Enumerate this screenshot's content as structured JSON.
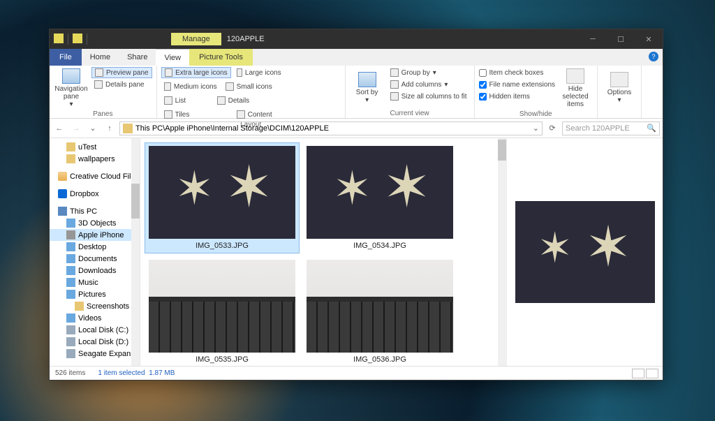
{
  "title": "120APPLE",
  "context_tab": "Manage",
  "ribbon_tabs": {
    "file": "File",
    "home": "Home",
    "share": "Share",
    "view": "View",
    "tools": "Picture Tools"
  },
  "panes": {
    "label": "Panes",
    "nav": "Navigation pane",
    "preview": "Preview pane",
    "details": "Details pane"
  },
  "layout": {
    "label": "Layout",
    "xl": "Extra large icons",
    "lg": "Large icons",
    "md": "Medium icons",
    "sm": "Small icons",
    "list": "List",
    "det": "Details",
    "tiles": "Tiles",
    "content": "Content"
  },
  "currentview": {
    "label": "Current view",
    "sort": "Sort by",
    "group": "Group by",
    "addcols": "Add columns",
    "sizecols": "Size all columns to fit"
  },
  "showhide": {
    "label": "Show/hide",
    "checkboxes": "Item check boxes",
    "ext": "File name extensions",
    "hidden": "Hidden items",
    "hidesel": "Hide selected items"
  },
  "options": "Options",
  "address": "This PC\\Apple iPhone\\Internal Storage\\DCIM\\120APPLE",
  "search_placeholder": "Search 120APPLE",
  "tree": {
    "utest": "uTest",
    "wallpapers": "wallpapers",
    "ccf": "Creative Cloud Files",
    "dropbox": "Dropbox",
    "thispc": "This PC",
    "obj3d": "3D Objects",
    "iphone": "Apple iPhone",
    "desktop": "Desktop",
    "documents": "Documents",
    "downloads": "Downloads",
    "music": "Music",
    "pictures": "Pictures",
    "screenshots": "Screenshots",
    "videos": "Videos",
    "diskc": "Local Disk (C:)",
    "diskd": "Local Disk (D:)",
    "seagate": "Seagate Expansion Drive"
  },
  "files": [
    {
      "name": "IMG_0533.JPG",
      "kind": "star",
      "selected": true
    },
    {
      "name": "IMG_0534.JPG",
      "kind": "star",
      "selected": false
    },
    {
      "name": "IMG_0535.JPG",
      "kind": "kb",
      "selected": false
    },
    {
      "name": "IMG_0536.JPG",
      "kind": "kb",
      "selected": false
    }
  ],
  "status": {
    "count": "526 items",
    "sel": "1 item selected",
    "size": "1.87 MB"
  }
}
